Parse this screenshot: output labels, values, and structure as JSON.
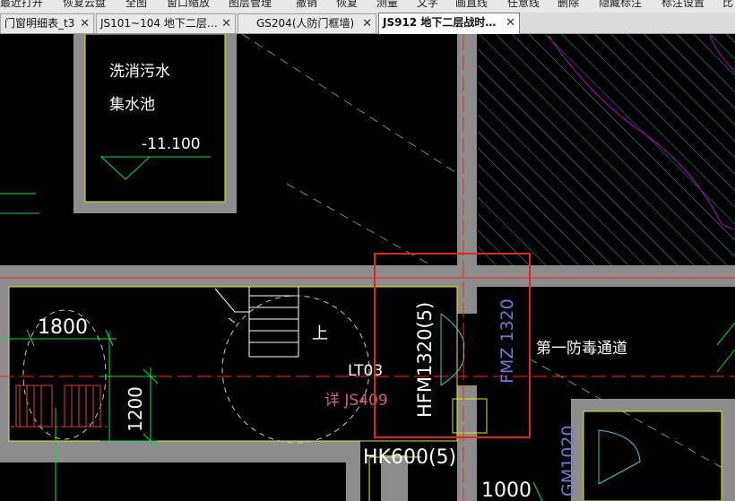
{
  "menu": [
    "最近打开",
    "恢复云盘",
    "全图",
    "窗口缩放",
    "图层管理",
    "撤销",
    "恢复",
    "测量",
    "文字",
    "画直线",
    "任意线",
    "删除",
    "隐藏标注",
    "标注设置",
    "比"
  ],
  "tabs": [
    {
      "label": "门窗明细表_t3",
      "active": false
    },
    {
      "label": "JS101~104 地下二层…",
      "active": false
    },
    {
      "label": "GS204(人防门框墙)",
      "active": false
    },
    {
      "label": "JS912 地下二层战时…",
      "active": true
    }
  ],
  "tab_close_glyph": "✕",
  "drawing": {
    "room_label_line1": "洗消污水",
    "room_label_line2": "集水池",
    "elevation": "-11.100",
    "dim_1800": "1800",
    "dim_1200": "1200",
    "up_label": "上",
    "stair_id": "LT03",
    "stair_ref": "详 JS409",
    "door_hfm": "HFM1320(5)",
    "door_fmz": "FMZ 1320",
    "passage_label": "第一防毒通道",
    "opening_hk": "HK600(5)",
    "dim_1000": "1000",
    "door_gm": "GM1020"
  },
  "colors": {
    "wall": "#8c8c8c",
    "text_white": "#ffffff",
    "hatch": "#2fa7c8",
    "magenta": "#c000d0",
    "axis_red": "#ff2020",
    "dim_green": "#00e040",
    "yellow": "#e6e61e",
    "highlight_red": "#e02424",
    "fmz_blue": "#6a7bd8",
    "ref_pink": "#d06070"
  }
}
